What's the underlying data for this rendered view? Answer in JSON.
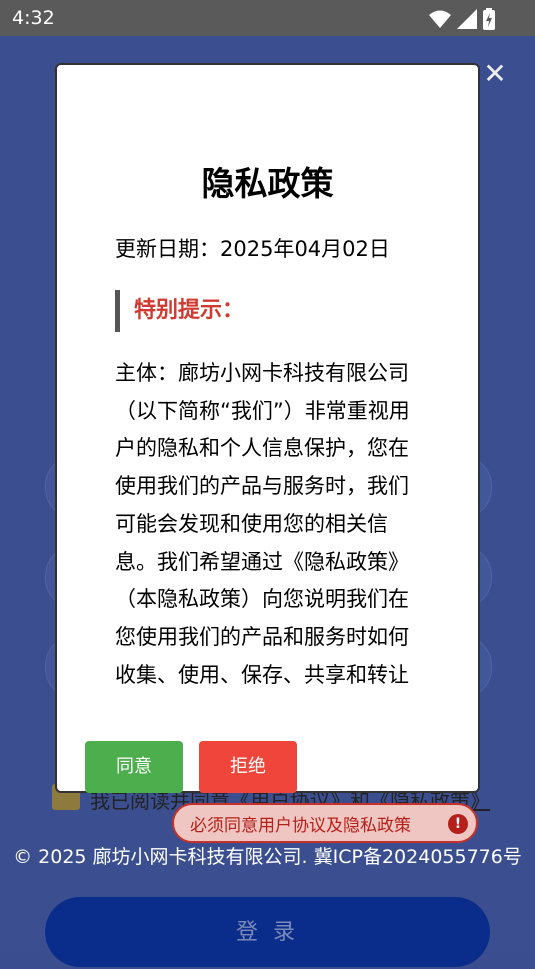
{
  "status_bar": {
    "time": "4:32",
    "icons": [
      "wifi-icon",
      "signal-icon",
      "battery-icon"
    ]
  },
  "background": {
    "agree_prefix": "我已阅读并同意",
    "user_agreement_link": "《用户协议》",
    "and": "和",
    "privacy_link": "《隐私政策》",
    "warning": "必须同意用户协议及隐私政策",
    "footer": "© 2025 廊坊小网卡科技有限公司. 冀ICP备2024055776号",
    "login_label": "登 录"
  },
  "dialog": {
    "title": "隐私政策",
    "update_date": "更新日期：2025年04月02日",
    "notice_heading": "特别提示：",
    "body": "主体：廊坊小网卡科技有限公司（以下简称“我们”）非常重视用户的隐私和个人信息保护，您在使用我们的产品与服务时，我们可能会发现和使用您的相关信息。我们希望通过《隐私政策》（本隐私政策）向您说明我们在您使用我们的产品和服务时如何收集、使用、保存、共享和转让这些信息。",
    "agree_label": "同意",
    "reject_label": "拒绝",
    "close_icon": "close-icon"
  },
  "colors": {
    "background": "#3b4f90",
    "agree_button": "#4cae4c",
    "reject_button": "#f0453a",
    "notice": "#d03a30",
    "login_button": "#0a2d8c"
  }
}
